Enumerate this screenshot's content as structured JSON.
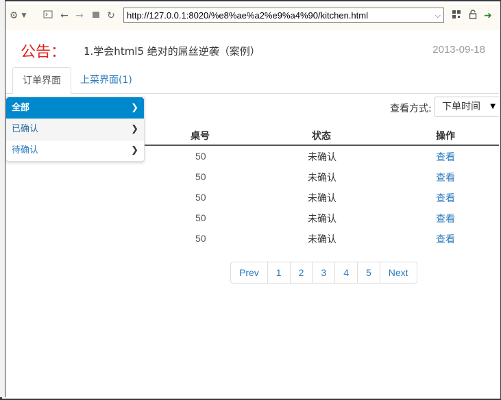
{
  "browser": {
    "url": "http://127.0.0.1:8020/%e8%ae%a2%e9%a4%90/kitchen.html"
  },
  "notice": {
    "label": "公告：",
    "text": "1.学会html5 绝对的屌丝逆袭（案例）",
    "date": "2013-09-18"
  },
  "tabs": [
    {
      "label": "订单界面"
    },
    {
      "label": "上菜界面(1)"
    }
  ],
  "menu": {
    "items": [
      {
        "label": "全部"
      },
      {
        "label": "已确认"
      },
      {
        "label": "待确认"
      }
    ]
  },
  "view": {
    "label": "查看方式:",
    "selected": "下单时间"
  },
  "table": {
    "headers": [
      "桌号",
      "状态",
      "操作"
    ],
    "rows": [
      {
        "table_no": "50",
        "status": "未确认",
        "action": "查看"
      },
      {
        "table_no": "50",
        "status": "未确认",
        "action": "查看"
      },
      {
        "table_no": "50",
        "status": "未确认",
        "action": "查看"
      },
      {
        "table_no": "50",
        "status": "未确认",
        "action": "查看"
      },
      {
        "table_no": "50",
        "status": "未确认",
        "action": "查看"
      }
    ]
  },
  "pagination": [
    "Prev",
    "1",
    "2",
    "3",
    "4",
    "5",
    "Next"
  ]
}
